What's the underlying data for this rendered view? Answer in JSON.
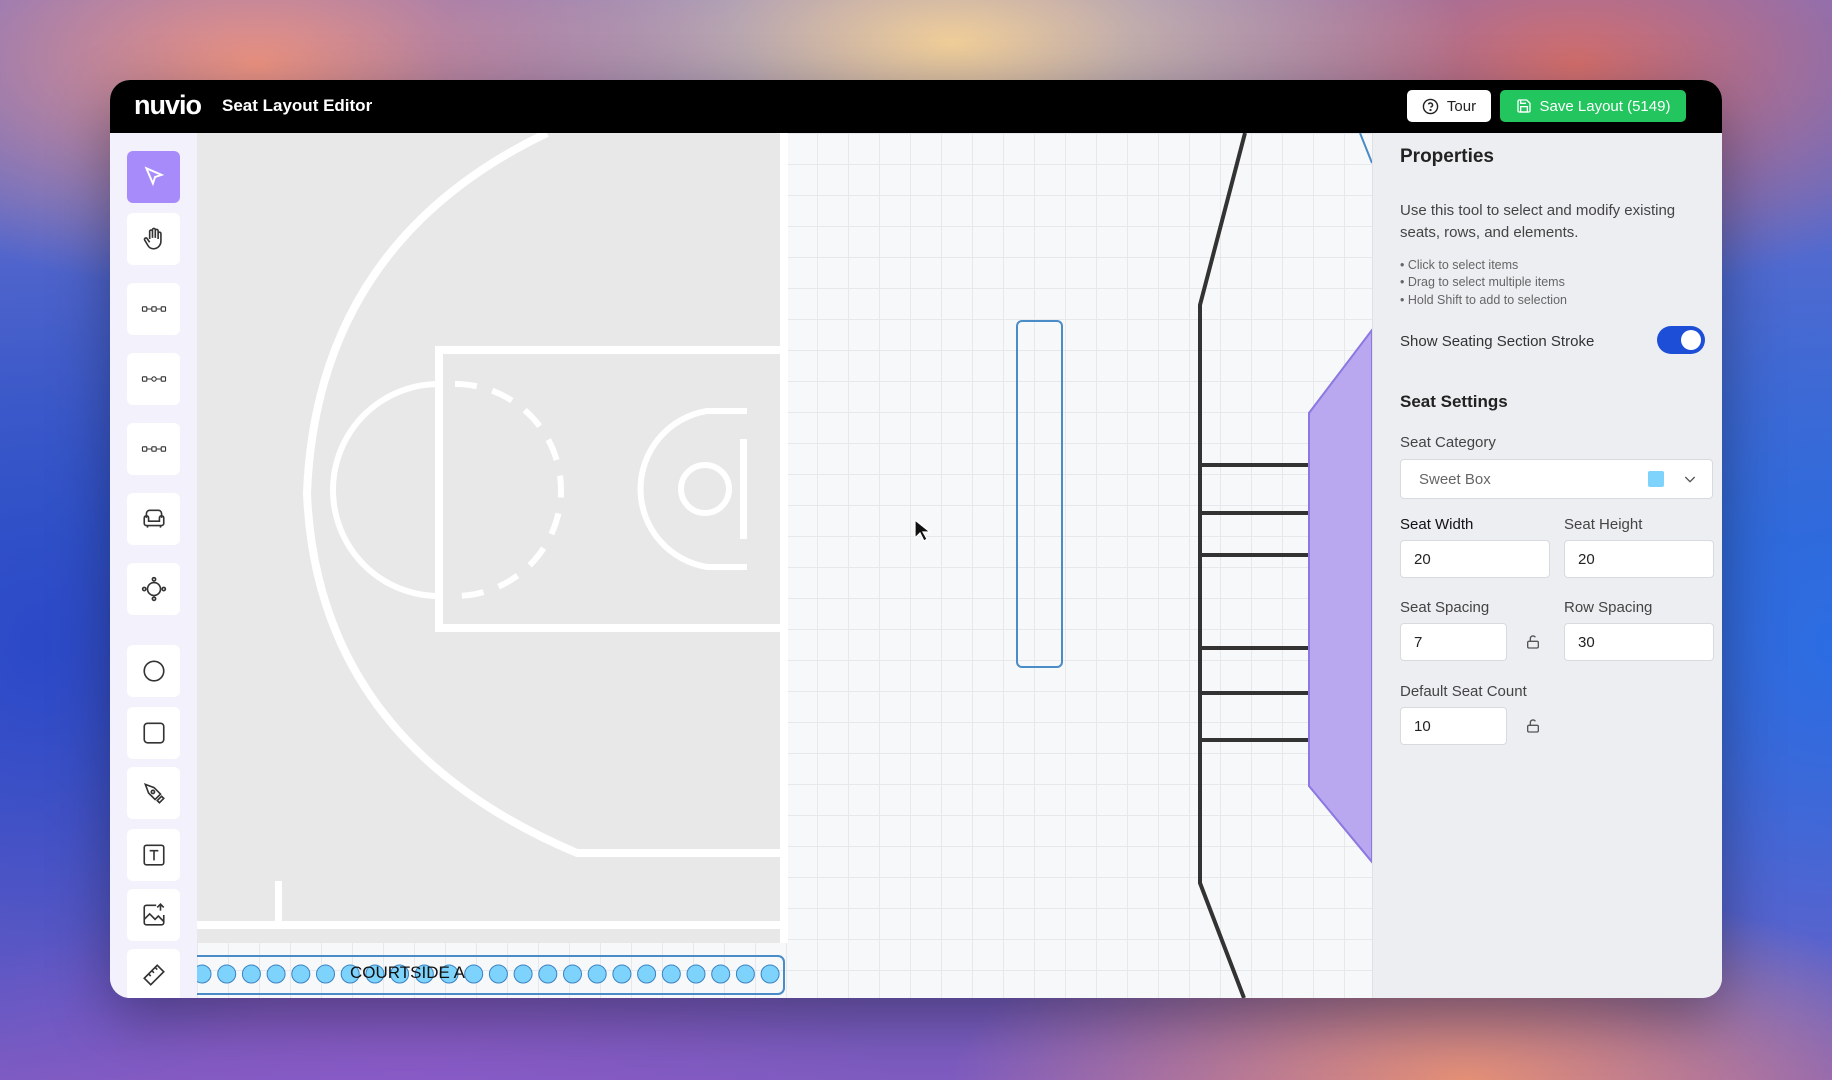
{
  "app": {
    "logo": "nuvio",
    "title": "Seat Layout Editor"
  },
  "header": {
    "tour_label": "Tour",
    "save_label": "Save Layout (5149)"
  },
  "toolbar": {
    "tools": [
      "select-tool",
      "pan-tool",
      "row-tool",
      "multi-row-tool",
      "segmented-row-tool",
      "seat-tool",
      "round-table-tool",
      "circle-tool",
      "rectangle-tool",
      "pen-tool",
      "text-tool",
      "image-tool",
      "measure-tool"
    ],
    "active_tool": "select-tool"
  },
  "canvas": {
    "row_label": "COURTSIDE A",
    "seat_color": "#7dd3fc",
    "section_color": "#b9a8ef",
    "court_color": "#e8e8e8"
  },
  "properties": {
    "title": "Properties",
    "description": "Use this tool to select and modify existing seats, rows, and elements.",
    "tips": [
      "• Click to select items",
      "• Drag to select multiple items",
      "• Hold Shift to add to selection"
    ],
    "stroke_toggle_label": "Show Seating Section Stroke",
    "stroke_toggle_on": true
  },
  "seat_settings": {
    "title": "Seat Settings",
    "category_label": "Seat Category",
    "category_value": "Sweet Box",
    "category_color": "#7dd3fc",
    "width_label": "Seat Width",
    "width_value": "20",
    "height_label": "Seat Height",
    "height_value": "20",
    "spacing_label": "Seat Spacing",
    "spacing_value": "7",
    "row_spacing_label": "Row Spacing",
    "row_spacing_value": "30",
    "count_label": "Default Seat Count",
    "count_value": "10"
  }
}
